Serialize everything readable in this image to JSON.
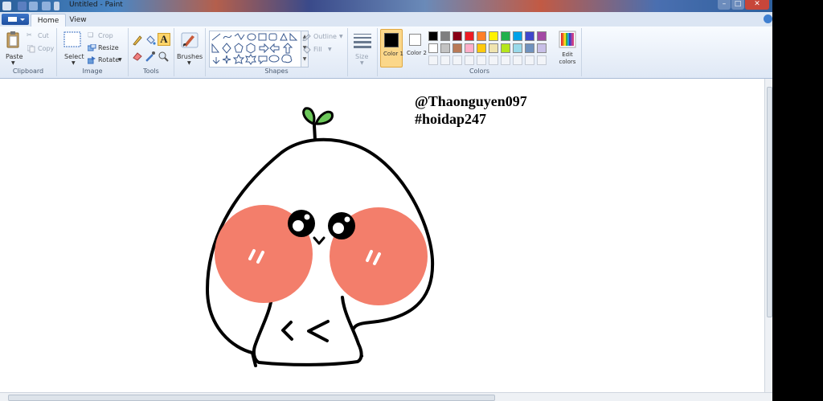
{
  "window": {
    "title": "Untitled - Paint"
  },
  "tabs": {
    "home": "Home",
    "view": "View"
  },
  "clipboard": {
    "paste": "Paste",
    "cut": "Cut",
    "copy": "Copy",
    "group": "Clipboard"
  },
  "image": {
    "select": "Select",
    "crop": "Crop",
    "resize": "Resize",
    "rotate": "Rotate",
    "group": "Image"
  },
  "tools": {
    "group": "Tools"
  },
  "brushes": {
    "label": "Brushes"
  },
  "shapes": {
    "outline": "Outline",
    "fill": "Fill",
    "group": "Shapes"
  },
  "size": {
    "label": "Size"
  },
  "colors": {
    "color1": "Color 1",
    "color1_num": "1",
    "color2": "Color 2",
    "color2_num": "2",
    "edit": "Edit colors",
    "group": "Colors",
    "color1_value": "#000000",
    "color2_value": "#ffffff",
    "palette_row1": [
      "#000000",
      "#7f7f7f",
      "#880015",
      "#ed1c24",
      "#ff7f27",
      "#fff200",
      "#22b14c",
      "#00a2e8",
      "#3f48cc",
      "#a349a4"
    ],
    "palette_row2": [
      "#ffffff",
      "#c3c3c3",
      "#b97a57",
      "#ffaec9",
      "#ffc90e",
      "#efe4b0",
      "#b5e61d",
      "#99d9ea",
      "#7092be",
      "#c8bfe7"
    ]
  },
  "canvas": {
    "text_line1": "@Thaonguyen097",
    "text_line2": "#hoidap247"
  }
}
